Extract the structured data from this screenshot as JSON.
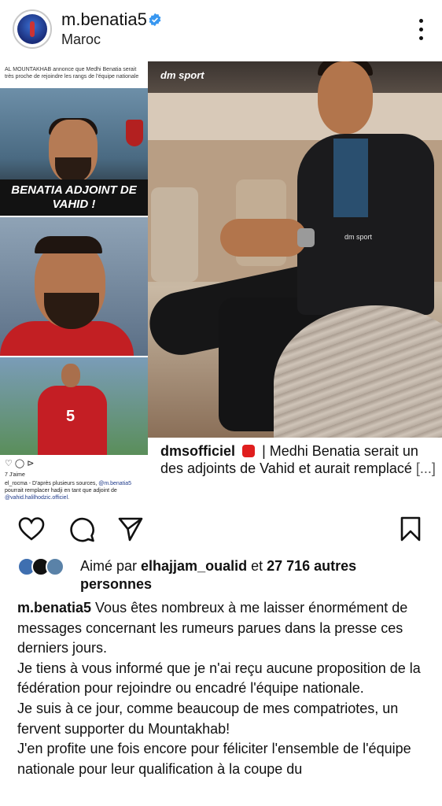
{
  "header": {
    "username": "m.benatia5",
    "location": "Maroc",
    "verified_icon": "verified-badge-icon",
    "more_icon": "more-options-icon"
  },
  "media": {
    "left_panel": {
      "caption": "AL MOUNTAKHAB annonce que Medhi Benatia serait très proche de rejoindre les rangs de l'équipe nationale",
      "banner": "BENATIA ADJOINT DE VAHID !",
      "jersey_number": "5",
      "icons": "♡ ◯ ⊳",
      "likes": "7 J'aime",
      "comment_user": "el_rocma",
      "comment_text": "- D'après plusieurs sources,",
      "comment_mention1": "@m.benatia5",
      "comment_mid": "pourrait remplacer hadji en tant que adjoint de",
      "comment_mention2": "@vahid.halilhodzic.officiel",
      "comment_end": "."
    },
    "right_panel": {
      "logo": "dm sport",
      "watermark": "dm sport",
      "caption_user": "dmsofficiel",
      "caption_text": "| Medhi Benatia serait un des adjoints de Vahid et aurait remplacé",
      "caption_more": "[...]"
    }
  },
  "actions": {
    "like_icon": "heart-icon",
    "comment_icon": "comment-icon",
    "share_icon": "send-icon",
    "save_icon": "bookmark-icon"
  },
  "likes": {
    "prefix": "Aimé par ",
    "user": "elhajjam_oualid",
    "mid": " et ",
    "count": "27 716 autres personnes"
  },
  "caption": {
    "user": "m.benatia5",
    "p1": " Vous êtes nombreux à me laisser énormément de messages concernant les rumeurs parues dans la presse ces derniers jours.",
    "p2": "Je tiens à vous informé que je n'ai reçu aucune proposition de la fédération pour rejoindre ou encadré l'équipe nationale.",
    "p3": "Je suis à ce jour, comme beaucoup de mes compatriotes, un fervent supporter du Mountakhab!",
    "p4": "J'en profite une fois encore pour féliciter l'ensemble de l'équipe nationale pour leur qualification à la coupe du"
  },
  "colors": {
    "verified": "#3897f0",
    "text": "#111111",
    "shirt_red": "#c21f23"
  }
}
